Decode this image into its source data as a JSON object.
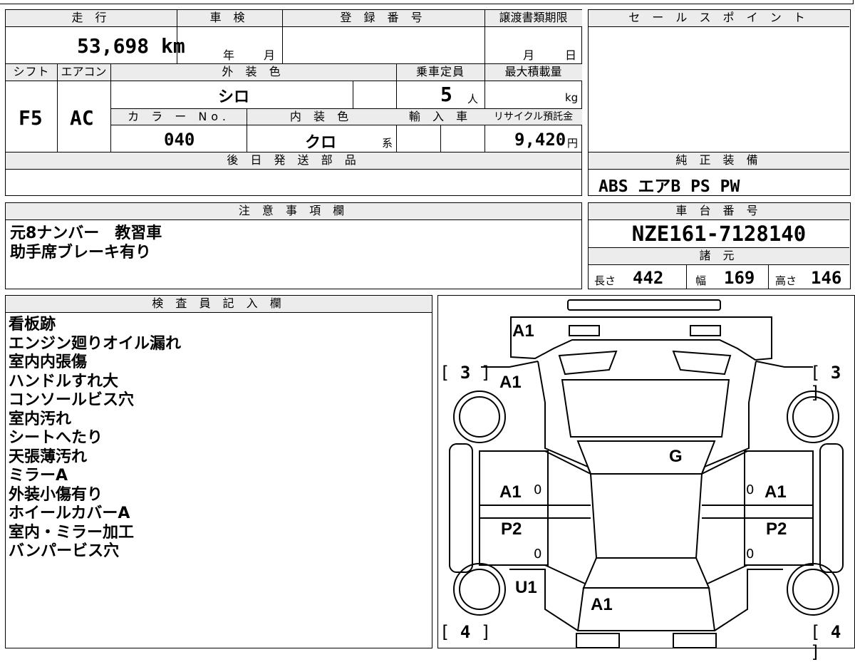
{
  "headers": {
    "mileage": "走 行",
    "inspection": "車 検",
    "registration": "登 録 番 号",
    "transfer_deadline": "譲渡書類期限",
    "sales_point": "セ ー ル ス ポ イ ン ト",
    "shift": "シフト",
    "aircon": "エアコン",
    "exterior_color": "外 装 色",
    "capacity": "乗車定員",
    "max_load": "最大積載量",
    "color_no": "カ ラ ー No.",
    "interior_color": "内 装 色",
    "import": "輸 入 車",
    "recycle": "リサイクル預託金",
    "later_parts": "後 日 発 送 部 品",
    "genuine_equipment": "純 正 装 備",
    "notes": "注 意 事 項 欄",
    "chassis_number": "車 台 番 号",
    "specs": "諸 元",
    "inspector_notes": "検 査 員 記 入 欄"
  },
  "values": {
    "mileage": "53,698 km",
    "year_label": "年",
    "month_label": "月",
    "deadline_month": "月",
    "deadline_day": "日",
    "shift": "F5",
    "aircon": "AC",
    "exterior_color": "シロ",
    "capacity": "5",
    "capacity_unit": "人",
    "max_load_unit": "kg",
    "color_no": "040",
    "interior_color": "クロ",
    "interior_suffix": "系",
    "recycle_amount": "9,420",
    "recycle_unit": "円",
    "genuine_equipment": "ABS エアB PS PW",
    "chassis_number": "NZE161-7128140",
    "length_label": "長さ",
    "length": "442",
    "width_label": "幅",
    "width": "169",
    "height_label": "高さ",
    "height": "146"
  },
  "notes": [
    "元8ナンバー　教習車",
    "助手席ブレーキ有り"
  ],
  "inspector_notes": [
    "看板跡",
    "エンジン廻りオイル漏れ",
    "室内内張傷",
    "ハンドルすれ大",
    "コンソールビス穴",
    "室内汚れ",
    "シートへたり",
    "天張薄汚れ",
    "ミラーA",
    "外装小傷有り",
    "ホイールカバーA",
    "室内・ミラー加工",
    "バンパービス穴"
  ],
  "damage_map": {
    "front_bumper": "A1",
    "hood": "A1",
    "roof": "G",
    "left_front_door": "A1",
    "right_front_door": "A1",
    "left_rear_door": "P2",
    "right_rear_door": "P2",
    "left_rear_quarter": "U1",
    "trunk": "A1",
    "tire_fl": "3",
    "tire_fr": "3",
    "tire_rl": "4",
    "tire_rr": "4",
    "zero": "0"
  }
}
